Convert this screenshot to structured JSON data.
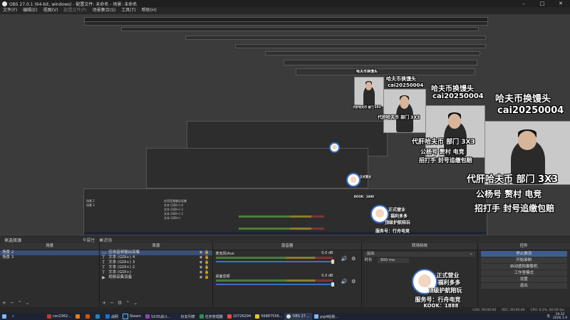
{
  "window": {
    "title": "OBS 27.0.1 (64-bit, windows) - 配置文件: 未命名 - 场景: 未命名",
    "controls": [
      "minimize-icon",
      "maximize-icon",
      "close-icon"
    ]
  },
  "menu": {
    "items": [
      "文件(F)",
      "编辑(E)",
      "视图(V)",
      "配置文件(P)",
      "场景集合(S)",
      "工具(T)",
      "帮助(H)"
    ]
  },
  "overlay": {
    "line1": "哈夫币换馒头",
    "line2": "cai20250004",
    "line3": "代肝哈夫币 部门 3X3",
    "line4": "公杨号 赘村 电竞",
    "line5": "招打手 封号追缴包赔",
    "badge_line1": "正式营业",
    "badge_line2": "福利多多",
    "badge_line3": "顶级护航陪玩",
    "badge_line4": "服务号：行舟电竞",
    "badge_line5": "KOOK：1888"
  },
  "bar": {
    "left_tab": "来选择源",
    "props_label": "属性",
    "filters_label": "滤镜"
  },
  "scenes": {
    "header": "场景",
    "items": [
      "场景 2",
      "场景 3"
    ]
  },
  "sources": {
    "header": "来源",
    "items": [
      {
        "icon": "monitor-icon",
        "label": "应用音频输出采集"
      },
      {
        "icon": "text-icon",
        "label": "文本 (GDI+) 4"
      },
      {
        "icon": "text-icon",
        "label": "文本 (GDI+) 3"
      },
      {
        "icon": "text-icon",
        "label": "文本 (GDI+) 2"
      },
      {
        "icon": "text-icon",
        "label": "文本 (GDI+)"
      },
      {
        "icon": "camera-icon",
        "label": "视频采集设备"
      }
    ]
  },
  "mixer": {
    "header": "混音器",
    "channels": [
      {
        "name": "麦克风/Aux",
        "db": "0.0 dB"
      },
      {
        "name": "桌面音频",
        "db": "0.0 dB"
      }
    ]
  },
  "transitions": {
    "header": "转场特效",
    "type": "淡出",
    "duration_label": "时长",
    "duration_value": "300 ms"
  },
  "controls": {
    "header": "控件",
    "buttons": [
      "停止推流",
      "开始录制",
      "启动虚拟摄像机",
      "工作室模式",
      "设置",
      "退出"
    ]
  },
  "status": {
    "live": "LIVE: 00:00:00",
    "rec": "REC: 00:00:00",
    "cpu": "CPU: 0.2%, 60.00 fps"
  },
  "taskbar": {
    "items": [
      "csn2362...",
      "",
      "",
      "",
      "战网",
      "Steam",
      "5X35战斗...",
      "好友列表",
      "任务管理器",
      "10726294",
      "56887556...",
      "OBS 27....",
      "pig4给我..."
    ],
    "tray": {
      "lang": "英",
      "time": "19:32",
      "date": "2026.1.9"
    }
  }
}
